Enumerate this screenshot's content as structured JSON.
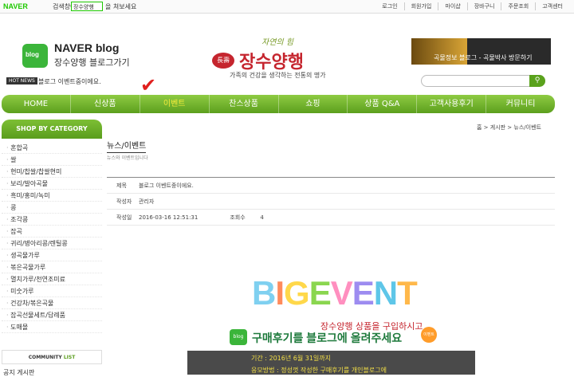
{
  "topbar": {
    "naver_brand": "NAVER",
    "naver_search_label": "검색창에",
    "naver_search_value": "장수양행",
    "naver_search_suffix": "을 쳐보세요",
    "util_links": [
      "로그인",
      "회원가입",
      "마이샵",
      "장바구니",
      "주문조회",
      "고객센터"
    ]
  },
  "header": {
    "blog_logo_icon_text": "blog",
    "blog_logo_line1": "NAVER blog",
    "blog_logo_line2": "장수양행 블로그가기",
    "hot_news_label": "HOT NEWS",
    "hot_news_text": "블로그 이벤트중이에요.",
    "brand_mark": "長壽",
    "brand_tagline_top": "자연의 힘",
    "brand_name": "장수양행",
    "brand_subtitle": "가족의 건강을 생각하는 전통의 명가",
    "ad_banner_text": "곡물정보 블로그 - 곡물박사 방문하기",
    "search_placeholder": ""
  },
  "gnb": {
    "items": [
      {
        "label": "HOME",
        "active": false
      },
      {
        "label": "신상품",
        "active": false
      },
      {
        "label": "이벤트",
        "active": true
      },
      {
        "label": "찬스상품",
        "active": false
      },
      {
        "label": "쇼핑",
        "active": false
      },
      {
        "label": "상품 Q&A",
        "active": false
      },
      {
        "label": "고객사용후기",
        "active": false
      },
      {
        "label": "커뮤니티",
        "active": false
      }
    ]
  },
  "sidebar": {
    "title": "SHOP BY CATEGORY",
    "items": [
      "혼합곡",
      "쌀",
      "현미/찹쌀/찹쌀현미",
      "보리/발아곡물",
      "흑미/홍미/녹미",
      "콩",
      "조각콩",
      "잡곡",
      "귀리/병아리콩/렌틸콩",
      "생곡물가루",
      "볶은곡물가루",
      "멸치가루/천연조미료",
      "미숫가루",
      "건강차/볶은곡물",
      "잡곡선물세트/답례품",
      "도매몰"
    ],
    "community_label_a": "COMMUNITY",
    "community_label_b": "LIST",
    "more_item": "공지 게시판"
  },
  "main": {
    "breadcrumb": "홈 > 게시판 > 뉴스/이벤트",
    "page_title": "뉴스/이벤트",
    "page_desc": "뉴스와 이벤트입니다",
    "board": {
      "subject_label": "제목",
      "subject_value": "블로그 이벤트중이에요.",
      "author_label": "작성자",
      "author_value": "관리자",
      "date_label": "작성일",
      "date_value": "2016-03-16 12:51:31",
      "views_label": "조회수",
      "views_value": "4"
    },
    "event": {
      "big_event_letters": [
        "B",
        "I",
        "G",
        "E",
        "V",
        "E",
        "N",
        "T"
      ],
      "line1": "장수양행 상품을 구입하시고",
      "blog_icon_text": "blog",
      "line2": "구매후기를 블로그에 올려주세요",
      "badge_text": "이벤트",
      "period": "기간 : 2016년 6월 31일까지",
      "method": "응모방법 : 정성껏 작성한 구매후기를 개인블로그에"
    }
  },
  "colors": {
    "green": "#5c9f1d",
    "active_nav": "#f3ea3a",
    "brand_red": "#c5252e"
  }
}
